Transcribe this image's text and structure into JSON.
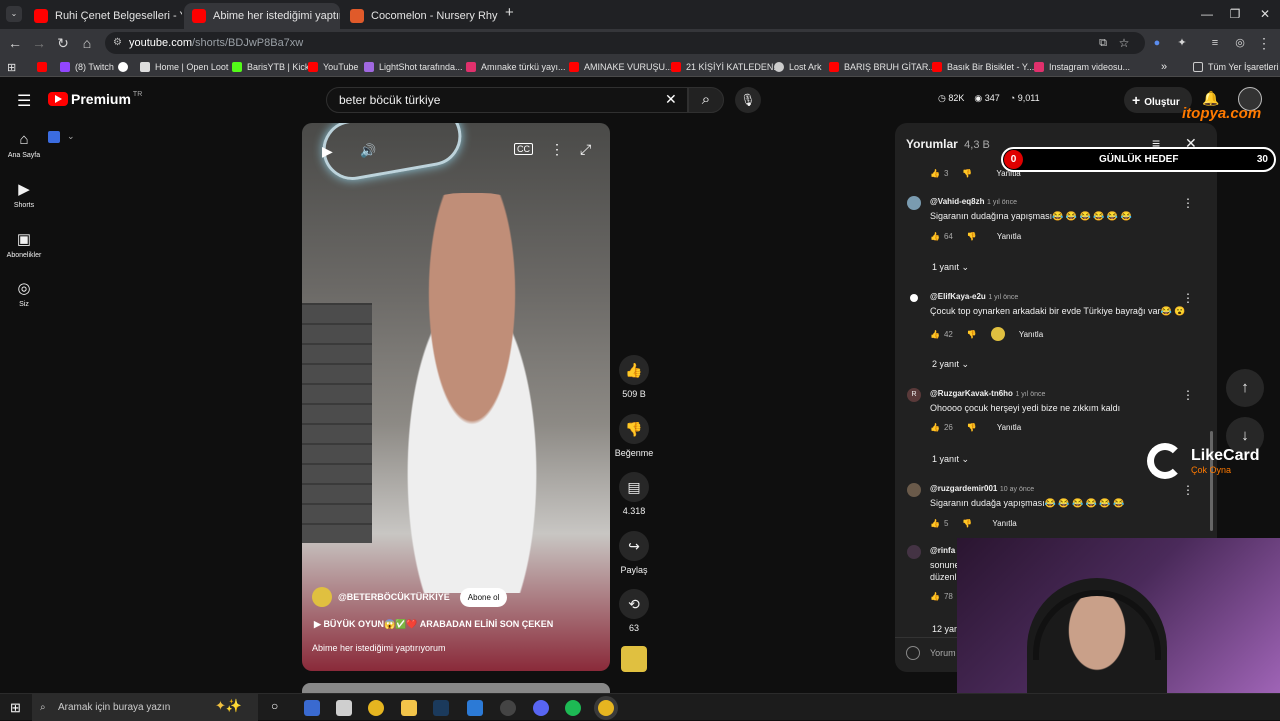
{
  "browser": {
    "tabs": [
      {
        "title": "Ruhi Çenet Belgeselleri - YouTu",
        "favicon_color": "#ff0000"
      },
      {
        "title": "Abime her istediğimi yaptıryorı",
        "favicon_color": "#ff0000"
      },
      {
        "title": "Cocomelon - Nursery Rhymes'",
        "favicon_color": "#e05a2a"
      }
    ],
    "new_tab": "+",
    "address_host": "youtube.com",
    "address_path": "/shorts/BDJwP8Ba7xw",
    "bookmarks": [
      {
        "label": "",
        "color": "#ff0000"
      },
      {
        "label": "(8) Twitch",
        "color": "#9146ff"
      },
      {
        "label": "",
        "color": "#ffffff"
      },
      {
        "label": "Home | Open Loot",
        "color": "#ffffff"
      },
      {
        "label": "BarisYTB | Kick",
        "color": "#53fc18"
      },
      {
        "label": "YouTube",
        "color": "#ff0000"
      },
      {
        "label": "LightShot tarafında...",
        "color": "#a068e0"
      },
      {
        "label": "Amınake türkü yayı...",
        "color": "#e1306c"
      },
      {
        "label": "AMINAKE VURUŞU...",
        "color": "#ff0000"
      },
      {
        "label": "21 KİŞİYİ KATLEDEN...",
        "color": "#ff0000"
      },
      {
        "label": "Lost Ark",
        "color": "#cccccc"
      },
      {
        "label": "BARIŞ BRUH GİTAR...",
        "color": "#ff0000"
      },
      {
        "label": "Basık Bir Bisiklet - Y...",
        "color": "#ff0000"
      },
      {
        "label": "Instagram videosu...",
        "color": "#e1306c"
      }
    ],
    "all_bookmarks": "Tüm Yer İşaretleri"
  },
  "youtube": {
    "logo": "Premium",
    "logo_region": "TR",
    "search_value": "beter böcük türkiye",
    "stats": {
      "a": "82K",
      "b": "347",
      "c": "9,011"
    },
    "create_label": "Oluştur",
    "sidebar": [
      {
        "label": "Ana Sayfa",
        "icon": "home-icon"
      },
      {
        "label": "Shorts",
        "icon": "shorts-icon"
      },
      {
        "label": "Abonelikler",
        "icon": "subscriptions-icon"
      },
      {
        "label": "Siz",
        "icon": "you-icon"
      }
    ],
    "channel_name": "@BETERBÖCÜKTÜRKİYE",
    "subscribe_label": "Abone ol",
    "video_link": "BÜYÜK OYUN😱✅❤️ ARABADAN ELİNİ SON ÇEKEN",
    "video_title": "Abime her istediğimi yaptırıyorum",
    "actions": {
      "like_count": "509 B",
      "dislike_label": "Beğenme",
      "comment_count": "4.318",
      "share_label": "Paylaş",
      "remix_count": "63"
    }
  },
  "comments": {
    "title": "Yorumlar",
    "count": "4,3 B",
    "goal_label": "GÜNLÜK HEDEF",
    "goal_current": "0",
    "goal_target": "30",
    "first_like": "3",
    "reply_label": "Yanıtla",
    "items": [
      {
        "user": "@Vahid-eq8zh",
        "time": "1 yıl önce",
        "text": "Sigaranın dudağına yapışması😂 😂 😂 😂 😂 😂",
        "likes": "64",
        "replies": "1 yanıt"
      },
      {
        "user": "@ElifKaya-e2u",
        "time": "1 yıl önce",
        "text": "Çocuk top oynarken arkadaki bir evde Türkiye bayrağı var😂 😮",
        "likes": "42",
        "replies": "2 yanıt"
      },
      {
        "user": "@RuzgarKavak-tn6ho",
        "time": "1 yıl önce",
        "text": "Ohoooo çocuk herşeyi yedi bize ne zıkkım kaldı",
        "likes": "26",
        "replies": "1 yanıt"
      },
      {
        "user": "@ruzgardemir001",
        "time": "10 ay önce",
        "text": "Sigaranın dudağa yapışması😂 😂 😂 😂 😂 😂",
        "likes": "5",
        "replies": ""
      },
      {
        "user": "@rinfa",
        "time": "",
        "text": "sonune",
        "text2": "düzenl",
        "likes": "78",
        "replies": "12 yan"
      }
    ],
    "input_placeholder": "Yorum"
  },
  "overlay": {
    "sponsor_name": "LikeCard",
    "sponsor_tag": "Çok Oyna",
    "site_tag": "itopya.com"
  },
  "taskbar": {
    "search_placeholder": "Aramak için buraya yazın"
  }
}
